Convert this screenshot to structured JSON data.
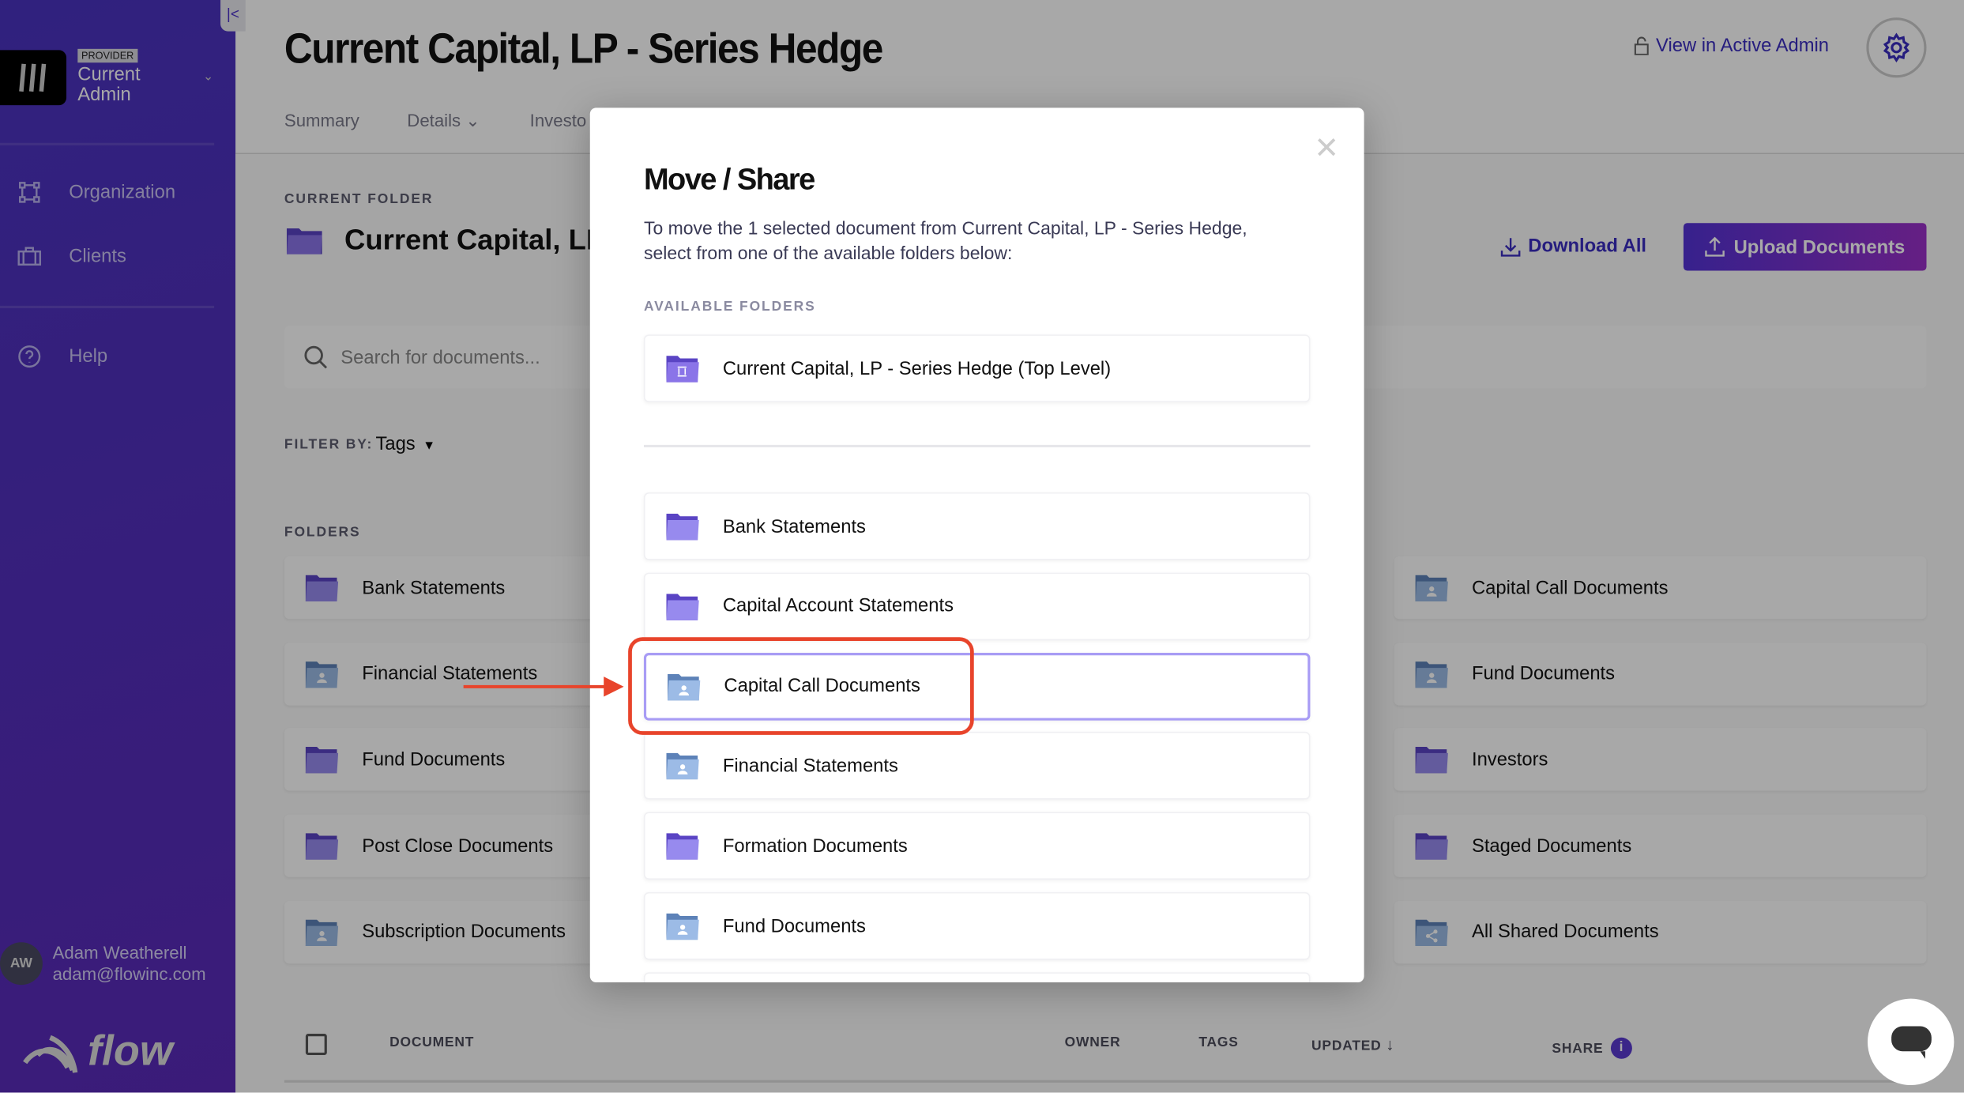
{
  "sidebar": {
    "badge": "PROVIDER",
    "org_line1": "Current",
    "org_line2": "Admin",
    "items": [
      {
        "label": "Organization",
        "icon": "organization-icon"
      },
      {
        "label": "Clients",
        "icon": "briefcase-icon"
      },
      {
        "label": "Help",
        "icon": "help-icon"
      }
    ],
    "user": {
      "initials": "AW",
      "name": "Adam Weatherell",
      "email": "adam@flowinc.com"
    },
    "logo_text": "flow"
  },
  "header": {
    "title": "Current Capital, LP - Series Hedge",
    "tabs": [
      "Summary",
      "Details",
      "Investo"
    ],
    "view_admin": "View in Active Admin"
  },
  "main": {
    "current_folder_label": "CURRENT FOLDER",
    "current_folder": "Current Capital, LP",
    "download_all": "Download All",
    "upload": "Upload Documents",
    "search_placeholder": "Search for documents...",
    "filter_label": "FILTER BY:",
    "filter_value": "Tags",
    "folders_label": "FOLDERS",
    "folders_left": [
      {
        "name": "Bank Statements",
        "type": "private"
      },
      {
        "name": "Financial Statements",
        "type": "shared"
      },
      {
        "name": "Fund Documents",
        "type": "private"
      },
      {
        "name": "Post Close Documents",
        "type": "private"
      },
      {
        "name": "Subscription Documents",
        "type": "shared"
      }
    ],
    "folders_right": [
      {
        "name": "Capital Call Documents",
        "type": "shared"
      },
      {
        "name": "Fund Documents",
        "type": "shared"
      },
      {
        "name": "Investors",
        "type": "private"
      },
      {
        "name": "Staged Documents",
        "type": "private"
      },
      {
        "name": "All Shared Documents",
        "type": "share"
      }
    ],
    "table_headers": {
      "document": "DOCUMENT",
      "owner": "OWNER",
      "tags": "TAGS",
      "updated": "UPDATED",
      "share": "SHARE"
    }
  },
  "modal": {
    "title": "Move / Share",
    "description": "To move the 1 selected document from Current Capital, LP - Series Hedge, select from one of the available folders below:",
    "available_label": "AVAILABLE FOLDERS",
    "top_level": "Current Capital, LP - Series Hedge (Top Level)",
    "folders": [
      {
        "name": "Bank Statements",
        "type": "private"
      },
      {
        "name": "Capital Account Statements",
        "type": "private"
      },
      {
        "name": "Capital Call Documents",
        "type": "shared",
        "selected": true
      },
      {
        "name": "Financial Statements",
        "type": "shared"
      },
      {
        "name": "Formation Documents",
        "type": "private"
      },
      {
        "name": "Fund Documents",
        "type": "shared"
      },
      {
        "name": "",
        "type": "private"
      }
    ]
  },
  "colors": {
    "accent": "#4b30c8",
    "annotation": "#e8442b",
    "selected_border": "#a89cf5"
  }
}
